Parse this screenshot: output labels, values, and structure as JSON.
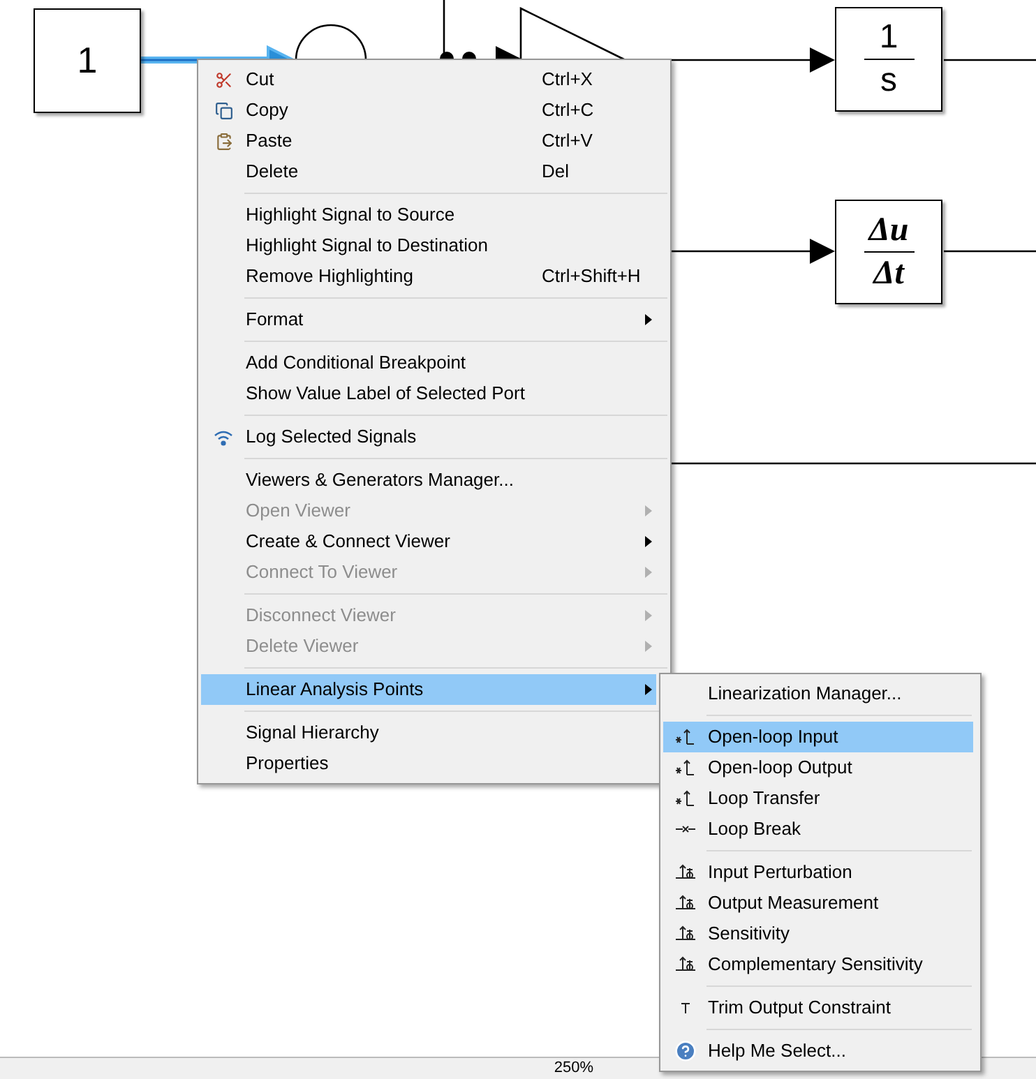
{
  "canvas": {
    "blocks": [
      {
        "kind": "constant",
        "label": "1"
      },
      {
        "kind": "integrator",
        "numerator": "1",
        "denominator": "s"
      },
      {
        "kind": "derivative",
        "numerator": "Δu",
        "denominator": "Δt"
      }
    ]
  },
  "context_menu": {
    "sections": [
      [
        {
          "label": "Cut",
          "shortcut": "Ctrl+X",
          "disabled": false,
          "submenu": false,
          "selected": false
        },
        {
          "label": "Copy",
          "shortcut": "Ctrl+C",
          "disabled": false,
          "submenu": false,
          "selected": false
        },
        {
          "label": "Paste",
          "shortcut": "Ctrl+V",
          "disabled": false,
          "submenu": false,
          "selected": false
        },
        {
          "label": "Delete",
          "shortcut": "Del",
          "disabled": false,
          "submenu": false,
          "selected": false
        }
      ],
      [
        {
          "label": "Highlight Signal to Source",
          "disabled": false,
          "submenu": false,
          "selected": false
        },
        {
          "label": "Highlight Signal to Destination",
          "disabled": false,
          "submenu": false,
          "selected": false
        },
        {
          "label": "Remove Highlighting",
          "shortcut": "Ctrl+Shift+H",
          "disabled": false,
          "submenu": false,
          "selected": false
        }
      ],
      [
        {
          "label": "Format",
          "disabled": false,
          "submenu": true,
          "selected": false
        }
      ],
      [
        {
          "label": "Add Conditional Breakpoint",
          "disabled": false,
          "submenu": false,
          "selected": false
        },
        {
          "label": "Show Value Label of Selected Port",
          "disabled": false,
          "submenu": false,
          "selected": false
        }
      ],
      [
        {
          "label": "Log Selected Signals",
          "disabled": false,
          "submenu": false,
          "selected": false
        }
      ],
      [
        {
          "label": "Viewers & Generators Manager...",
          "disabled": false,
          "submenu": false,
          "selected": false
        },
        {
          "label": "Open Viewer",
          "disabled": true,
          "submenu": true,
          "selected": false
        },
        {
          "label": "Create & Connect Viewer",
          "disabled": false,
          "submenu": true,
          "selected": false
        },
        {
          "label": "Connect To Viewer",
          "disabled": true,
          "submenu": true,
          "selected": false
        }
      ],
      [
        {
          "label": "Disconnect Viewer",
          "disabled": true,
          "submenu": true,
          "selected": false
        },
        {
          "label": "Delete Viewer",
          "disabled": true,
          "submenu": true,
          "selected": false
        }
      ],
      [
        {
          "label": "Linear Analysis Points",
          "disabled": false,
          "submenu": true,
          "selected": true
        }
      ],
      [
        {
          "label": "Signal Hierarchy",
          "disabled": false,
          "submenu": false,
          "selected": false
        },
        {
          "label": "Properties",
          "disabled": false,
          "submenu": false,
          "selected": false
        }
      ]
    ]
  },
  "submenu": {
    "sections": [
      [
        {
          "label": "Linearization Manager...",
          "selected": false
        }
      ],
      [
        {
          "label": "Open-loop Input",
          "selected": true
        },
        {
          "label": "Open-loop Output",
          "selected": false
        },
        {
          "label": "Loop Transfer",
          "selected": false
        },
        {
          "label": "Loop Break",
          "selected": false
        }
      ],
      [
        {
          "label": "Input Perturbation",
          "selected": false
        },
        {
          "label": "Output Measurement",
          "selected": false
        },
        {
          "label": "Sensitivity",
          "selected": false
        },
        {
          "label": "Complementary Sensitivity",
          "selected": false
        }
      ],
      [
        {
          "label": "Trim Output Constraint",
          "selected": false
        }
      ],
      [
        {
          "label": "Help Me Select...",
          "selected": false
        }
      ]
    ]
  },
  "status_bar": {
    "zoom": "250%"
  }
}
